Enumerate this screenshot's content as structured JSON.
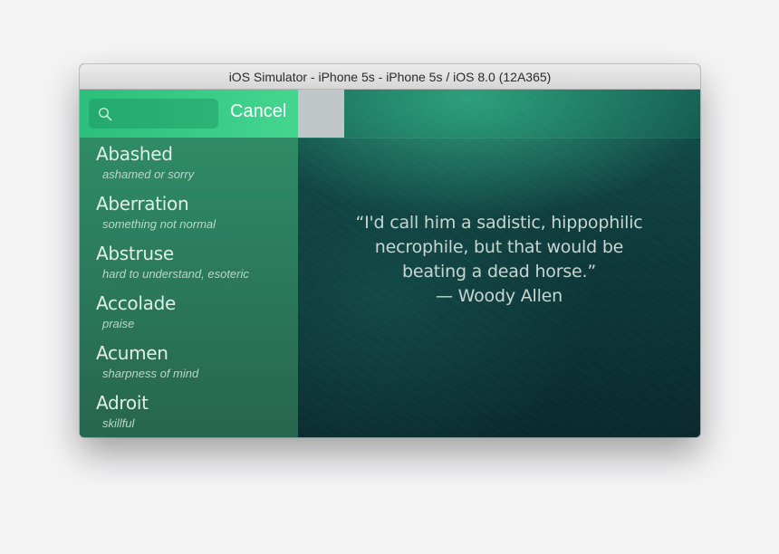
{
  "window": {
    "title": "iOS Simulator - iPhone 5s - iPhone 5s / iOS 8.0 (12A365)"
  },
  "search": {
    "placeholder": "",
    "value": "",
    "cancel_label": "Cancel"
  },
  "list": {
    "items": [
      {
        "word": "Abashed",
        "definition": "ashamed or sorry"
      },
      {
        "word": "Aberration",
        "definition": "something not normal"
      },
      {
        "word": "Abstruse",
        "definition": "hard to understand, esoteric"
      },
      {
        "word": "Accolade",
        "definition": "praise"
      },
      {
        "word": "Acumen",
        "definition": "sharpness of mind"
      },
      {
        "word": "Adroit",
        "definition": "skillful"
      }
    ]
  },
  "quote": {
    "lines": [
      "“I'd call him a sadistic, hippophilic",
      "necrophile, but that would be",
      "beating a dead horse.”",
      "— Woody Allen"
    ]
  },
  "colors": {
    "search_bar": "#44d68f",
    "list_background": "#2b7a5d",
    "background_dark": "#0b2a2e"
  }
}
